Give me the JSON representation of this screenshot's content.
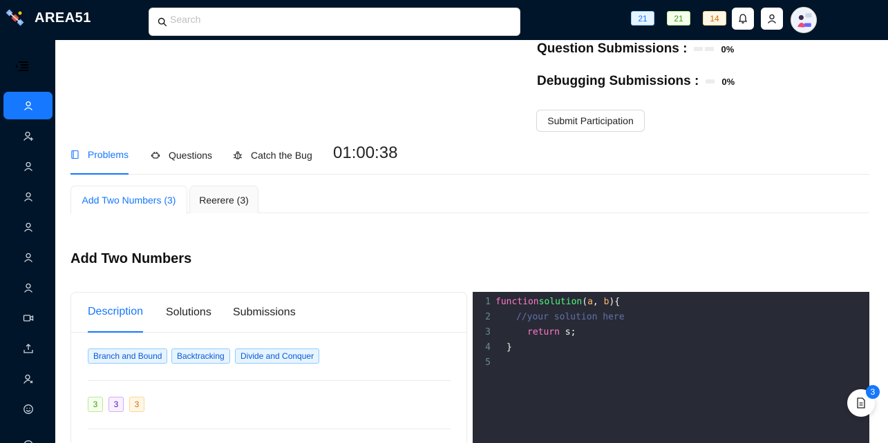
{
  "app": {
    "name": "AREA51"
  },
  "search": {
    "placeholder": "Search"
  },
  "header": {
    "badges": [
      "21",
      "21",
      "14"
    ],
    "colors": {
      "bar": "#001529",
      "accent": "#1677ff"
    },
    "icons": [
      "notification-bell-icon",
      "user-icon"
    ]
  },
  "sidebar": {
    "icons": [
      "menu-fold-icon",
      "user-icon",
      "user-add-icon",
      "user-icon",
      "user-icon",
      "user-icon",
      "user-icon",
      "user-icon",
      "video-camera-icon",
      "upload-icon",
      "user-switch-icon",
      "smile-icon"
    ]
  },
  "stats": {
    "question_label": "Question Submissions :",
    "question_pct": "0%",
    "debugging_label": "Debugging Submissions :",
    "debugging_pct": "0%"
  },
  "submit_label": "Submit Participation",
  "main_tabs": [
    {
      "label": "Problems",
      "icon": "book-icon"
    },
    {
      "label": "Questions",
      "icon": "android-icon"
    },
    {
      "label": "Catch the Bug",
      "icon": "bug-icon"
    }
  ],
  "timer": "01:00:38",
  "problem_tabs": [
    "Add Two Numbers (3)",
    "Reerere (3)"
  ],
  "problem": {
    "title": "Add Two Numbers",
    "tabs": [
      "Description",
      "Solutions",
      "Submissions"
    ],
    "tags": [
      "Branch and Bound",
      "Backtracking",
      "Divide and Conquer"
    ],
    "levels": [
      "3",
      "3",
      "3"
    ]
  },
  "editor": {
    "lines": [
      {
        "n": "1",
        "code": "function solution(a, b){"
      },
      {
        "n": "2",
        "code": "   //your solution here"
      },
      {
        "n": "3",
        "code": "      return s;"
      },
      {
        "n": "4",
        "code": "  }"
      },
      {
        "n": "5",
        "code": ""
      }
    ],
    "tokens": {
      "kw_function": "function",
      "fn_name": "solution",
      "paren_open": "(",
      "arg_a": "a",
      "comma": ", ",
      "arg_b": "b",
      "paren_close": "){",
      "comment": "//your solution here",
      "kw_return": "return",
      "ret_val": " s;",
      "brace_close": "}"
    }
  },
  "float_badge": "3"
}
